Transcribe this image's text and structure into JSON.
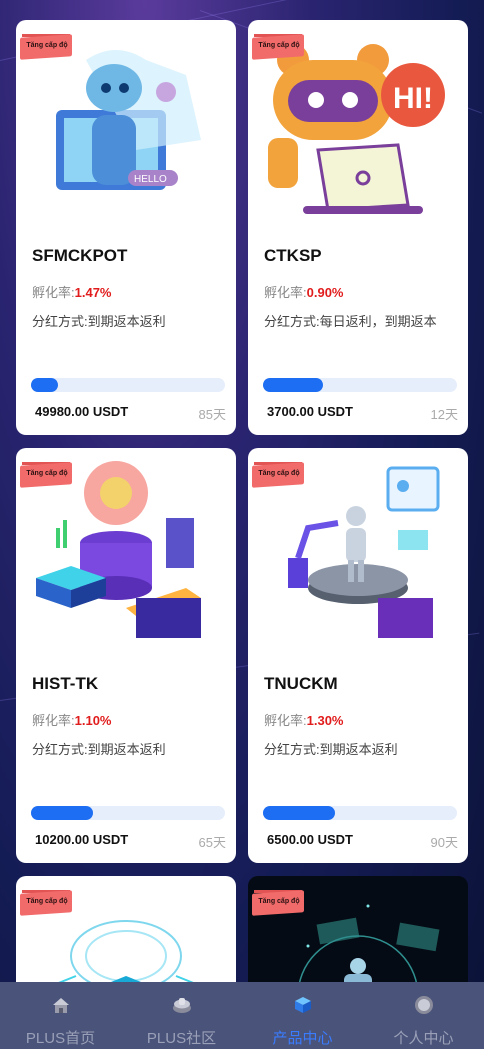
{
  "ribbon_text": "Tăng cấp độ",
  "products": [
    {
      "name": "SFMCKPOT",
      "rate_label": "孵化率:",
      "rate": "1.47%",
      "method": "分红方式:到期返本返利",
      "progress": 0.14,
      "amount": "49980.00 USDT",
      "days": "85天",
      "illustration": "robot-hello"
    },
    {
      "name": "CTKSP",
      "rate_label": "孵化率:",
      "rate": "0.90%",
      "method": "分红方式:每日返利，到期返本",
      "progress": 0.31,
      "amount": "3700.00 USDT",
      "days": "12天",
      "illustration": "robot-hi-laptop"
    },
    {
      "name": "HIST-TK",
      "rate_label": "孵化率:",
      "rate": "1.10%",
      "method": "分红方式:到期返本返利",
      "progress": 0.32,
      "amount": "10200.00 USDT",
      "days": "65天",
      "illustration": "isometric-server-gear"
    },
    {
      "name": "TNUCKM",
      "rate_label": "孵化率:",
      "rate": "1.30%",
      "method": "分红方式:到期返本返利",
      "progress": 0.37,
      "amount": "6500.00 USDT",
      "days": "90天",
      "illustration": "isometric-humanoid-robot"
    },
    {
      "illustration": "circuit-brain"
    },
    {
      "illustration": "dark-ai-hologram"
    }
  ],
  "tabbar": {
    "items": [
      {
        "label": "PLUS首页",
        "icon": "home-icon"
      },
      {
        "label": "PLUS社区",
        "icon": "community-icon"
      },
      {
        "label": "产品中心",
        "icon": "product-cube-icon",
        "active": true
      },
      {
        "label": "个人中心",
        "icon": "profile-icon"
      }
    ]
  },
  "colors": {
    "accent": "#1d6ef2",
    "rate": "#e11c1c",
    "ribbon": "#f26b6b",
    "tabbar": "#4a5379",
    "tab_active": "#3a7cff"
  }
}
